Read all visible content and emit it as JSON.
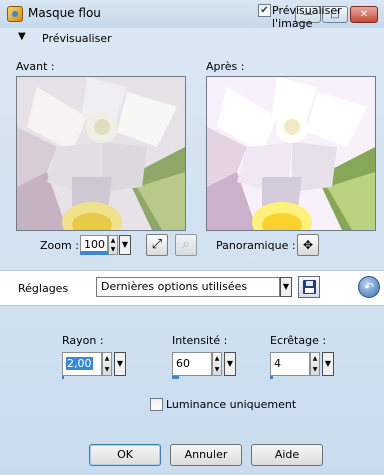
{
  "window": {
    "title": "Masque flou"
  },
  "title_buttons": {
    "minimize": "—",
    "maximize": "□",
    "close": "✕"
  },
  "preview_section": {
    "label": "Prévisualiser",
    "toggle_label": "Prévisualiser l'image",
    "toggle_checked": true
  },
  "panels": {
    "before_label": "Avant :",
    "after_label": "Après :"
  },
  "zoom": {
    "label": "Zoom :",
    "value": "100"
  },
  "pan": {
    "label": "Panoramique :"
  },
  "settings": {
    "label": "Réglages",
    "selected": "Dernières options utilisées"
  },
  "params": {
    "radius": {
      "label": "Rayon :",
      "value": "2,00"
    },
    "intensity": {
      "label": "Intensité :",
      "value": "60"
    },
    "clipping": {
      "label": "Ecrêtage :",
      "value": "4"
    }
  },
  "luminance": {
    "label": "Luminance uniquement",
    "checked": false
  },
  "buttons": {
    "ok": "OK",
    "cancel": "Annuler",
    "help": "Aide"
  },
  "icons": {
    "collapse": "triangle-down-icon",
    "fit": "fit-window-icon",
    "actual_size": "zoom-actual-icon",
    "pan": "move-cross-icon",
    "save": "floppy-disk-icon",
    "reset": "reset-arrow-icon"
  },
  "colors": {
    "accent": "#3a87d8",
    "window_bg": "#d3e3f2"
  }
}
